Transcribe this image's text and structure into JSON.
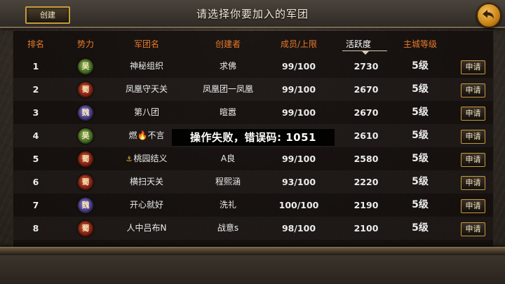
{
  "header": {
    "create_label": "创建",
    "title": "请选择你要加入的军团",
    "back_icon": "back-arrow-icon"
  },
  "columns": [
    "排名",
    "势力",
    "军团名",
    "创建者",
    "成员/上限",
    "活跃度",
    "主城等级"
  ],
  "active_column": "活跃度",
  "colors": {
    "header_text": "#e87a2a",
    "active_header_text": "#ffffff",
    "button_border": "#c79a3c",
    "wu": "#3c6220",
    "shu": "#7a1c10",
    "wei": "#3c3278"
  },
  "factions": {
    "wu": "吴",
    "shu": "蜀",
    "wei": "魏"
  },
  "rows": [
    {
      "rank": "1",
      "faction": "wu",
      "faction_glyph": "吴",
      "name": "神秘组织",
      "name_icon": "",
      "creator": "求佛",
      "members": "99/100",
      "activity": "2730",
      "level": "5级",
      "apply": "申请"
    },
    {
      "rank": "2",
      "faction": "shu",
      "faction_glyph": "蜀",
      "name": "凤凰守天关",
      "name_icon": "",
      "creator": "凤凰团一凤凰",
      "members": "99/100",
      "activity": "2670",
      "level": "5级",
      "apply": "申请"
    },
    {
      "rank": "3",
      "faction": "wei",
      "faction_glyph": "魏",
      "name": "第八团",
      "name_icon": "",
      "creator": "暄嚣",
      "members": "99/100",
      "activity": "2670",
      "level": "5级",
      "apply": "申请"
    },
    {
      "rank": "4",
      "faction": "wu",
      "faction_glyph": "吴",
      "name": "燃🔥不言",
      "name_icon": "",
      "creator": "",
      "members": "",
      "activity": "2610",
      "level": "5级",
      "apply": "申请"
    },
    {
      "rank": "5",
      "faction": "shu",
      "faction_glyph": "蜀",
      "name": "桃园结义",
      "name_icon": "⚓",
      "creator": "A良",
      "members": "99/100",
      "activity": "2580",
      "level": "5级",
      "apply": "申请"
    },
    {
      "rank": "6",
      "faction": "shu",
      "faction_glyph": "蜀",
      "name": "横扫天关",
      "name_icon": "",
      "creator": "程熙涵",
      "members": "93/100",
      "activity": "2220",
      "level": "5级",
      "apply": "申请"
    },
    {
      "rank": "7",
      "faction": "wei",
      "faction_glyph": "魏",
      "name": "开心就好",
      "name_icon": "",
      "creator": "洗礼",
      "members": "100/100",
      "activity": "2190",
      "level": "5级",
      "apply": "申请"
    },
    {
      "rank": "8",
      "faction": "shu",
      "faction_glyph": "蜀",
      "name": "人中吕布N",
      "name_icon": "",
      "creator": "战意s",
      "members": "98/100",
      "activity": "2100",
      "level": "5级",
      "apply": "申请"
    }
  ],
  "toast": {
    "message": "操作失败，错误码: 1051"
  }
}
